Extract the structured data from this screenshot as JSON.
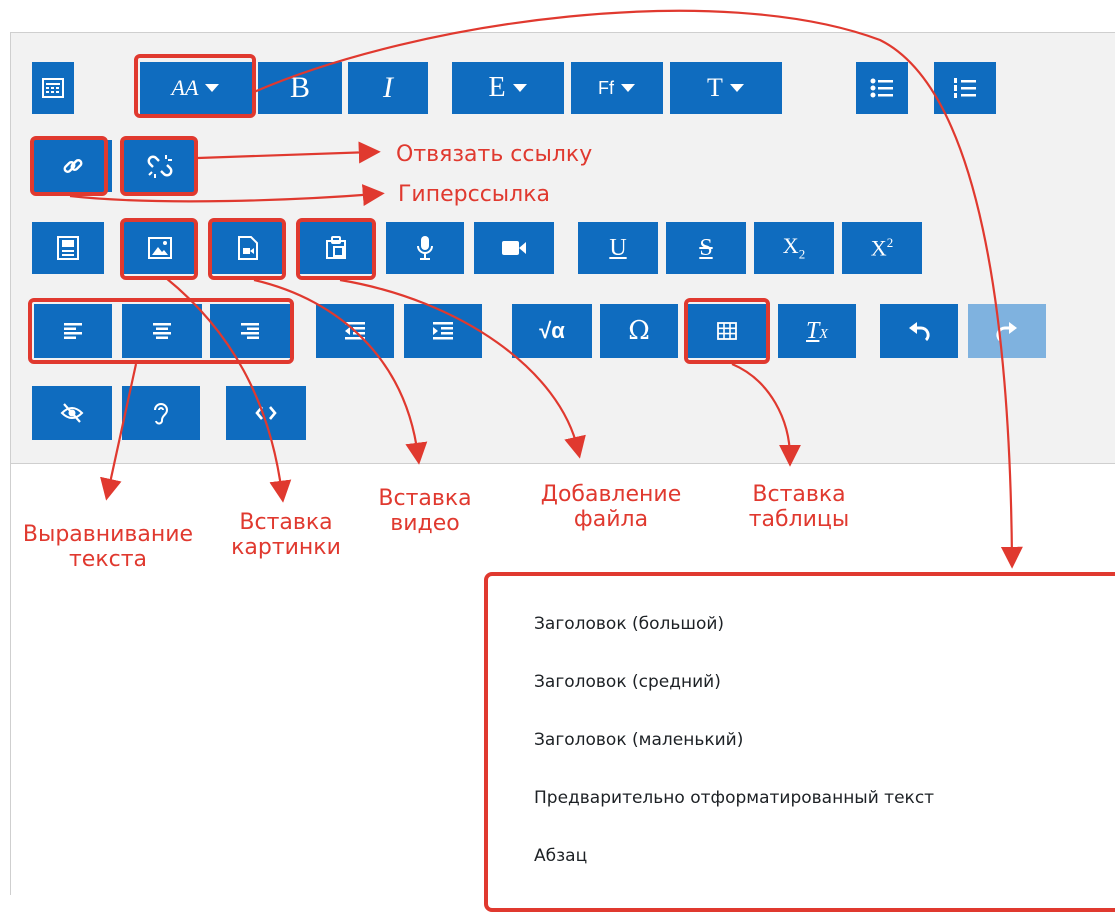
{
  "editor": {
    "toolbar": {
      "row1": [
        {
          "name": "show-more-buttons",
          "icon": "toolbar-toggle-icon"
        },
        {
          "name": "paragraph-styles",
          "label": "AA",
          "icon": "paragraph-styles-icon",
          "has_dropdown": true
        },
        {
          "name": "bold",
          "label": "B",
          "icon": "bold-icon"
        },
        {
          "name": "italic",
          "label": "I",
          "icon": "italic-icon"
        },
        {
          "name": "font-color",
          "label": "E",
          "icon": "font-color-icon",
          "has_dropdown": true
        },
        {
          "name": "font-family",
          "label": "Ff",
          "icon": "font-family-icon",
          "has_dropdown": true
        },
        {
          "name": "font-size",
          "label": "T",
          "icon": "font-size-icon",
          "has_dropdown": true
        },
        {
          "name": "unordered-list",
          "icon": "bullet-list-icon"
        },
        {
          "name": "ordered-list",
          "icon": "numbered-list-icon"
        }
      ],
      "row2": [
        {
          "name": "link",
          "icon": "link-icon"
        },
        {
          "name": "unlink",
          "icon": "unlink-icon"
        }
      ],
      "row3": [
        {
          "name": "paste-from-word",
          "icon": "word-icon"
        },
        {
          "name": "insert-image",
          "icon": "image-icon"
        },
        {
          "name": "insert-media",
          "icon": "video-file-icon"
        },
        {
          "name": "manage-files",
          "icon": "file-manager-icon"
        },
        {
          "name": "record-audio",
          "icon": "microphone-icon"
        },
        {
          "name": "record-video",
          "icon": "video-camera-icon"
        },
        {
          "name": "underline",
          "label": "U",
          "icon": "underline-icon"
        },
        {
          "name": "strikethrough",
          "label": "S",
          "icon": "strikethrough-icon"
        },
        {
          "name": "subscript",
          "label": "X2",
          "icon": "subscript-icon"
        },
        {
          "name": "superscript",
          "label": "X2",
          "icon": "superscript-icon"
        }
      ],
      "row4": [
        {
          "name": "align-left",
          "icon": "align-left-icon"
        },
        {
          "name": "align-center",
          "icon": "align-center-icon"
        },
        {
          "name": "align-right",
          "icon": "align-right-icon"
        },
        {
          "name": "outdent",
          "icon": "outdent-icon"
        },
        {
          "name": "indent",
          "icon": "indent-icon"
        },
        {
          "name": "equation",
          "label": "√α",
          "icon": "equation-icon"
        },
        {
          "name": "special-characters",
          "label": "Ω",
          "icon": "omega-icon"
        },
        {
          "name": "table",
          "icon": "table-icon"
        },
        {
          "name": "clear-formatting",
          "label": "Tx",
          "icon": "clear-formatting-icon"
        },
        {
          "name": "undo",
          "icon": "undo-icon"
        },
        {
          "name": "redo",
          "icon": "redo-icon",
          "disabled": true
        }
      ],
      "row5": [
        {
          "name": "accessibility-checker",
          "icon": "eye-slash-icon"
        },
        {
          "name": "screen-reader-helper",
          "icon": "ear-icon"
        },
        {
          "name": "html-source",
          "icon": "code-icon"
        }
      ]
    },
    "format_dropdown": {
      "items": [
        "Заголовок (большой)",
        "Заголовок (средний)",
        "Заголовок (маленький)",
        "Предварительно отформатированный текст",
        "Абзац"
      ]
    }
  },
  "annotations": {
    "unlink": "Отвязать ссылку",
    "hyperlink": "Гиперссылка",
    "text_alignment_line1": "Выравнивание",
    "text_alignment_line2": "текста",
    "insert_image_line1": "Вставка",
    "insert_image_line2": "картинки",
    "insert_video_line1": "Вставка",
    "insert_video_line2": "видео",
    "add_file_line1": "Добавление",
    "add_file_line2": "файла",
    "insert_table_line1": "Вставка",
    "insert_table_line2": "таблицы"
  },
  "colors": {
    "button": "#0f6cbf",
    "button_disabled": "#7fb2df",
    "toolbar_bg": "#f2f2f2",
    "annotation": "#e0392f"
  }
}
